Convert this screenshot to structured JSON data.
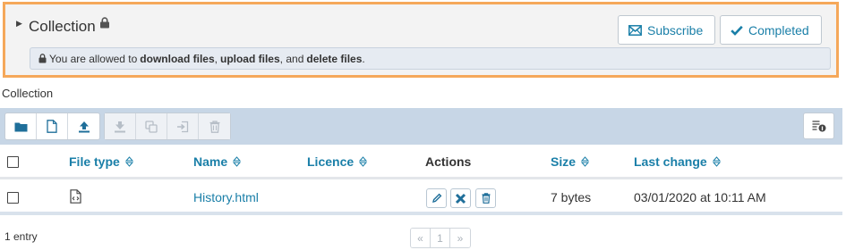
{
  "collection_panel": {
    "title": "Collection",
    "subscribe_label": "Subscribe",
    "completed_label": "Completed",
    "notice": {
      "prefix": "You are allowed to",
      "perm1": "download files",
      "sep1": ",",
      "perm2": "upload files",
      "sep2": ", and",
      "perm3": "delete files",
      "suffix": "."
    }
  },
  "section_title": "Collection",
  "toolbar": {
    "left_icons": [
      "folder-icon",
      "new-file-icon",
      "upload-icon"
    ],
    "disabled_icons": [
      "download-icon",
      "copy-icon",
      "move-icon",
      "trash-icon"
    ],
    "right_icon": "metadata-icon"
  },
  "table": {
    "columns": [
      "File type",
      "Name",
      "Licence",
      "Actions",
      "Size",
      "Last change"
    ],
    "rows": [
      {
        "file_type_icon": "html-file-icon",
        "name": "History.html",
        "licence": "",
        "actions": [
          "edit-icon",
          "edit-licence-icon",
          "delete-icon"
        ],
        "size": "7 bytes",
        "last_change": "03/01/2020 at 10:11 AM"
      }
    ]
  },
  "footer": {
    "entry_count": "1 entry",
    "pagination": {
      "prev": "«",
      "page": "1",
      "next": "»"
    }
  },
  "colors": {
    "accent": "#1a7fa8",
    "panel_border": "#f5a85a",
    "toolbar_bg": "#c7d6e6"
  }
}
